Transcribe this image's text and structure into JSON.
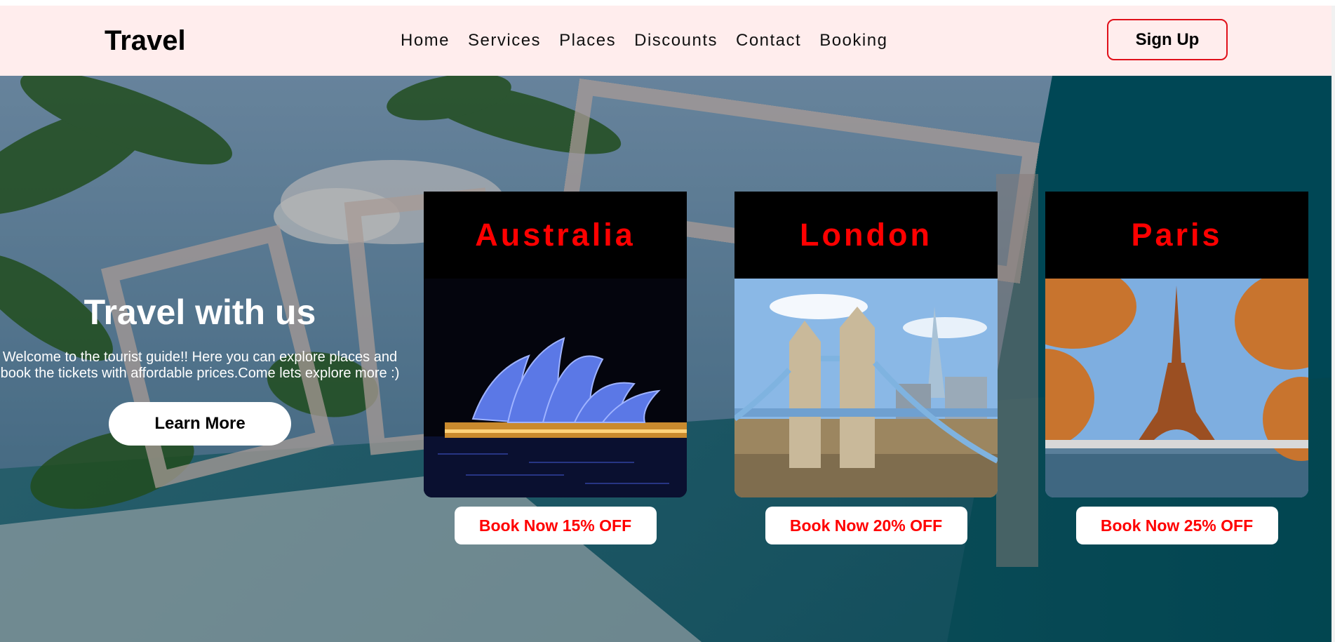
{
  "header": {
    "logo": "Travel",
    "nav": [
      "Home",
      "Services",
      "Places",
      "Discounts",
      "Contact",
      "Booking"
    ],
    "signup_label": "Sign Up"
  },
  "hero": {
    "title": "Travel with us",
    "text": "Welcome to the tourist guide!! Here you can explore places and book the tickets with affordable prices.Come lets explore more :)",
    "learn_more_label": "Learn More"
  },
  "destinations": [
    {
      "name": "Australia",
      "book_label": "Book Now 15% OFF",
      "image_icon": "sydney-opera-house"
    },
    {
      "name": "London",
      "book_label": "Book Now 20% OFF",
      "image_icon": "tower-bridge"
    },
    {
      "name": "Paris",
      "book_label": "Book Now 25% OFF",
      "image_icon": "eiffel-tower"
    }
  ],
  "colors": {
    "navbar_bg": "#ffeded",
    "accent_red": "#ff0000",
    "hero_teal": "#0b5e73"
  }
}
